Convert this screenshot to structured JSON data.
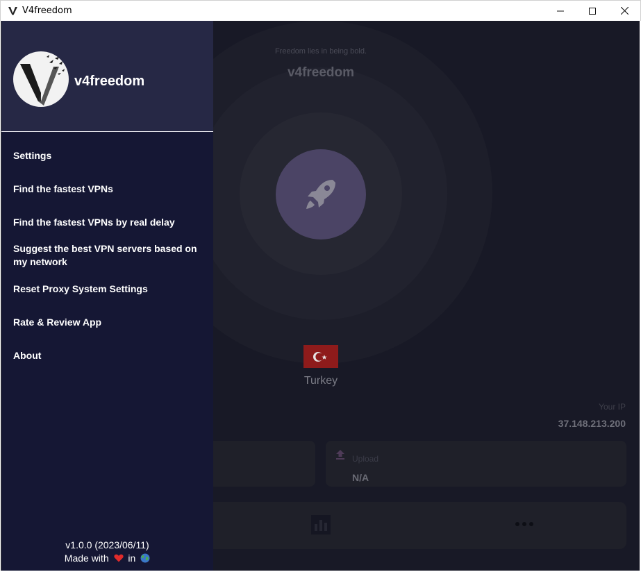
{
  "window": {
    "title": "V4freedom"
  },
  "main": {
    "tagline": "Freedom lies in being bold.",
    "brand": "v4freedom",
    "country": "Turkey",
    "ip_label": "Your IP",
    "ip_value": "37.148.213.200",
    "upload_label": "Upload",
    "upload_value": "N/A"
  },
  "drawer": {
    "title": "v4freedom",
    "items": [
      {
        "label": "Settings"
      },
      {
        "label": "Find the fastest VPNs"
      },
      {
        "label": "Find the fastest VPNs by real delay"
      },
      {
        "label": "Suggest the best VPN servers based on my network"
      },
      {
        "label": "Reset Proxy System Settings"
      },
      {
        "label": "Rate & Review App"
      },
      {
        "label": "About"
      }
    ],
    "version": "v1.0.0 (2023/06/11)",
    "made_with": "Made with",
    "made_in": "in"
  },
  "icons": {
    "app": "v4freedom-logo-icon",
    "connect": "rocket-icon",
    "upload": "upload-arrow-icon",
    "stats": "bar-chart-icon",
    "more": "more-dots-icon",
    "flag": "turkey-flag-icon",
    "heart": "heart-icon",
    "globe": "globe-icon"
  },
  "colors": {
    "drawer_bg": "#151734",
    "drawer_header_bg": "#262845",
    "main_bg": "#181926",
    "connect_button": "#4b4465",
    "heart": "#e02b2b"
  }
}
